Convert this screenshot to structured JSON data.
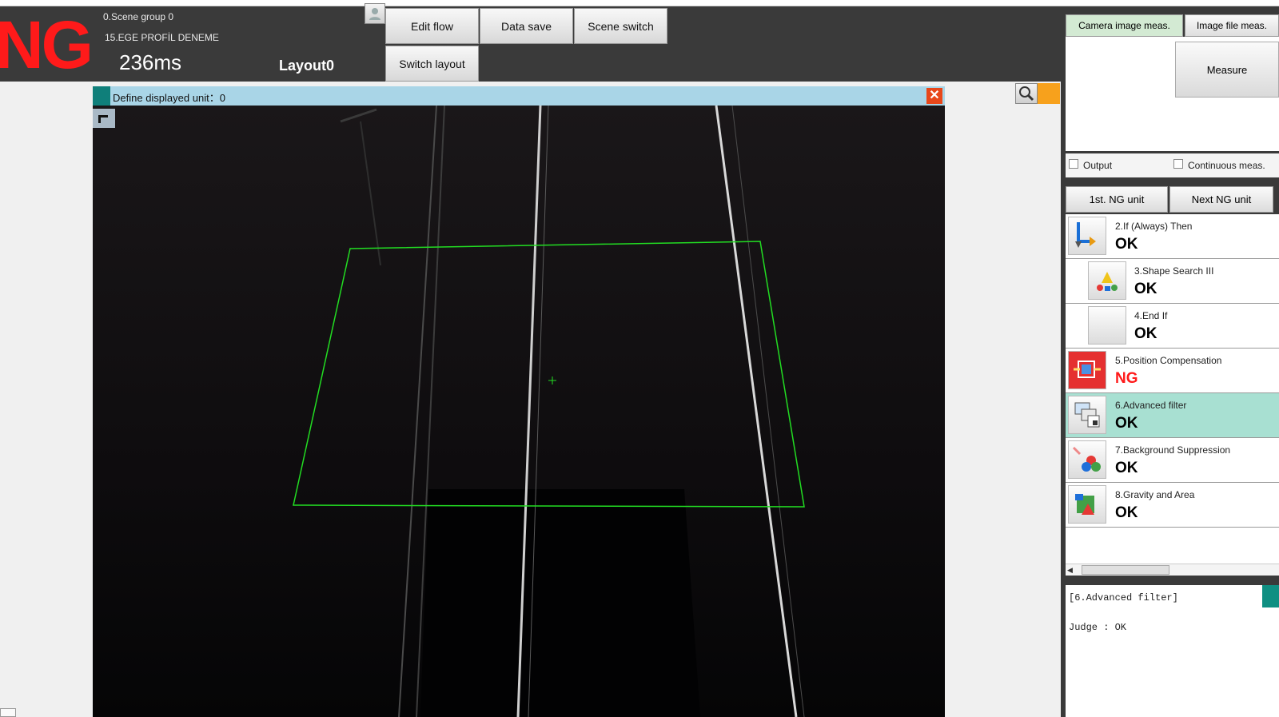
{
  "status": {
    "judgement": "NG",
    "judgement_color": "#ff1a1a",
    "scene_group": "0.Scene group 0",
    "scene": "15.EGE PROFİL DENEME",
    "processing_time": "236ms",
    "layout": "Layout0"
  },
  "toolbar": {
    "user_icon": "user-icon",
    "edit_flow": "Edit flow",
    "data_save": "Data save",
    "scene_switch": "Scene switch",
    "switch_layout": "Switch layout"
  },
  "viewer": {
    "title": "Define displayed unit：0",
    "close_icon": "close-icon",
    "roi_color": "#22dd22"
  },
  "measure_panel": {
    "tabs": [
      "Camera image meas.",
      "Image file meas."
    ],
    "active_tab": 0,
    "measure_label": "Measure",
    "output_label": "Output",
    "continuous_label": "Continuous meas.",
    "output_checked": false,
    "continuous_checked": false
  },
  "navigation": {
    "first_ng": "1st. NG unit",
    "next_ng": "Next NG unit"
  },
  "flow": [
    {
      "name": "2.If (Always) Then",
      "result": "OK",
      "icon": "if-branch-icon",
      "indent": 0,
      "selected": false
    },
    {
      "name": "3.Shape Search III",
      "result": "OK",
      "icon": "shape-search-icon",
      "indent": 1,
      "selected": false
    },
    {
      "name": "4.End If",
      "result": "OK",
      "icon": "end-if-icon",
      "indent": 1,
      "selected": false
    },
    {
      "name": "5.Position Compensation",
      "result": "NG",
      "icon": "position-compensation-icon",
      "indent": 0,
      "selected": false
    },
    {
      "name": "6.Advanced filter",
      "result": "OK",
      "icon": "advanced-filter-icon",
      "indent": 0,
      "selected": true
    },
    {
      "name": "7.Background Suppression",
      "result": "OK",
      "icon": "background-suppression-icon",
      "indent": 0,
      "selected": false
    },
    {
      "name": "8.Gravity and Area",
      "result": "OK",
      "icon": "gravity-area-icon",
      "indent": 0,
      "selected": false
    }
  ],
  "detail": {
    "unit": "[6.Advanced filter]",
    "judge": "Judge : OK"
  },
  "colors": {
    "ok": "#000000",
    "ng": "#ff1a1a",
    "selected_row": "#a8e0d2",
    "title_bar": "#a9d5e7"
  }
}
